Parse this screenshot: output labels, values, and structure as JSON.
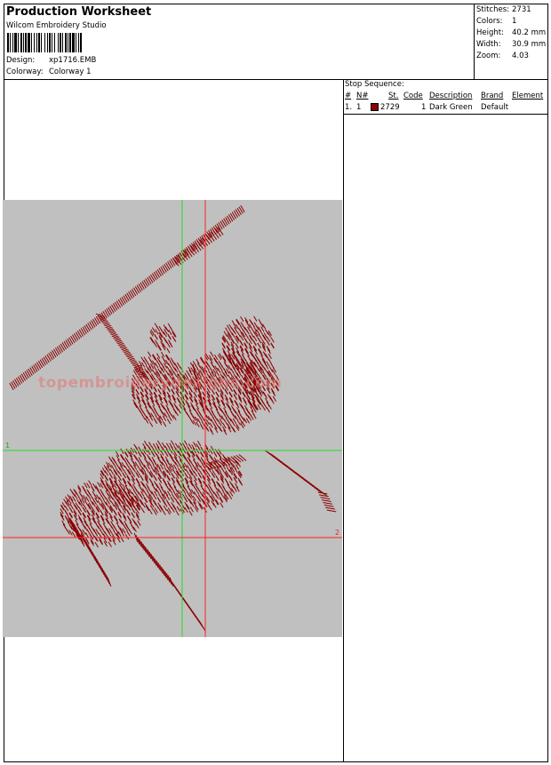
{
  "header": {
    "title": "Production Worksheet",
    "software": "Wilcom Embroidery Studio",
    "design_label": "Design:",
    "design_value": "xp1716.EMB",
    "colorway_label": "Colorway:",
    "colorway_value": "Colorway 1"
  },
  "stats": [
    {
      "label": "Stitches:",
      "value": "2731"
    },
    {
      "label": "Colors:",
      "value": "1"
    },
    {
      "label": "Height:",
      "value": "40.2 mm"
    },
    {
      "label": "Width:",
      "value": "30.9 mm"
    },
    {
      "label": "Zoom:",
      "value": "4.03"
    }
  ],
  "stop_sequence": {
    "label": "Stop Sequence:",
    "columns": [
      "#",
      "N#",
      "St.",
      "Code",
      "Description",
      "Brand",
      "Element"
    ],
    "rows": [
      {
        "index": "1.",
        "needle": "1",
        "stitches": "2729",
        "code": "1",
        "description": "Dark Green",
        "brand": "Default",
        "element": "",
        "color": "#8b0000"
      }
    ]
  },
  "design": {
    "watermark": "topembroiderydesigns.com",
    "crosshair_1_label": "1",
    "crosshair_2_label": "2",
    "thread_color": "#8b0000",
    "background_color": "#c0c0c0"
  }
}
